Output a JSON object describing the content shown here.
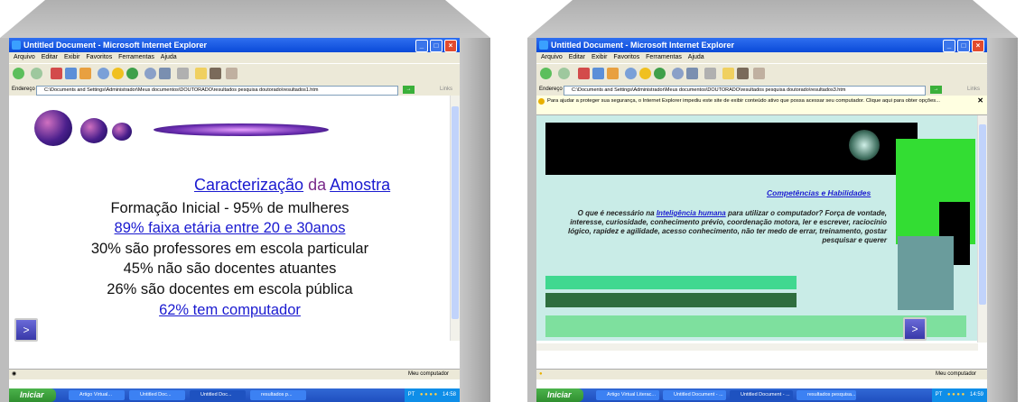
{
  "left": {
    "window_title": "Untitled Document - Microsoft Internet Explorer",
    "menu": [
      "Arquivo",
      "Editar",
      "Exibir",
      "Favoritos",
      "Ferramentas",
      "Ajuda"
    ],
    "address_label": "Endereço",
    "address": "C:\\Documents and Settings\\Administrador\\Meus documentos\\DOUTORADO\\resultados pesquisa doutorado\\resultados1.htm",
    "links_label": "Links",
    "title_part1": "Caracterização",
    "title_part2": "da",
    "title_part3": "Amostra",
    "lines": [
      "Formação Inicial - 95% de mulheres",
      "89% faixa etária entre 20 e 30anos",
      "30% são professores em escola particular",
      "45% não são docentes atuantes",
      "26% são docentes em escola pública",
      "62% tem computador"
    ],
    "status_right": "Meu computador",
    "start_label": "Iniciar",
    "tasks": [
      "Artigo Virtual...",
      "Untitled Doc...",
      "Untitled Doc...",
      "resultados p..."
    ],
    "tray": "PT",
    "clock": "14:58",
    "nav_icon": "next-arrow"
  },
  "right": {
    "window_title": "Untitled Document - Microsoft Internet Explorer",
    "menu": [
      "Arquivo",
      "Editar",
      "Exibir",
      "Favoritos",
      "Ferramentas",
      "Ajuda"
    ],
    "address_label": "Endereço",
    "address": "C:\\Documents and Settings\\Administrador\\Meus documentos\\DOUTORADO\\resultados pesquisa doutorado\\resultados3.htm",
    "links_label": "Links",
    "infobar": "Para ajudar a proteger sua segurança, o Internet Explorer impediu este site de exibir conteúdo ativo que possa acessar seu computador. Clique aqui para obter opções...",
    "heading": "Competências e Habilidades",
    "para_start": "O que é necessário na",
    "para_link": "Inteligência humana",
    "para_rest": "para utilizar o computador? Força de vontade, interesse, curiosidade, conhecimento prévio, coordenação motora, ler e escrever, raciocínio lógico, rapidez e agilidade, acesso conhecimento, não ter medo de errar, treinamento, gostar pesquisar e querer",
    "status_right": "Meu computador",
    "start_label": "Iniciar",
    "tasks": [
      "Artigo Virtual Literac...",
      "Untitled Document - ...",
      "Untitled Document - ...",
      "resultados pesquisa..."
    ],
    "tray": "PT",
    "clock": "14:59"
  }
}
